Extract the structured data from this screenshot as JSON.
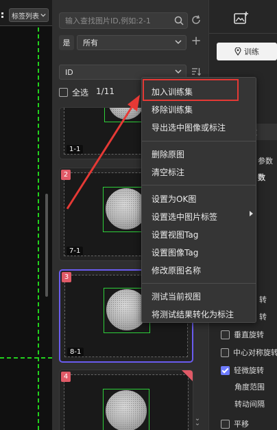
{
  "canvas": {
    "tag_list_label": "标签列表",
    "guide_color": "#23d11e"
  },
  "search": {
    "placeholder": "输入查找图片ID,例如:2-1"
  },
  "filter": {
    "operator": "是",
    "value": "所有"
  },
  "sort": {
    "field": "ID"
  },
  "selection": {
    "select_all_label": "全选",
    "count": "1/11"
  },
  "thumbnails": [
    {
      "index": "",
      "label": "1-1"
    },
    {
      "index": "2",
      "label": "7-1"
    },
    {
      "index": "3",
      "label": "8-1"
    },
    {
      "index": "4",
      "label": ""
    }
  ],
  "context_menu": {
    "items": [
      "加入训练集",
      "移除训练集",
      "导出选中图像或标注",
      "删除原图",
      "清空标注",
      "设置为OK图",
      "设置选中图片标签",
      "设置视图Tag",
      "设置图像Tag",
      "修改原图名称",
      "测试当前视图",
      "将测试结果转化为标注"
    ],
    "highlight_color": "#e53935"
  },
  "right_panel": {
    "train_button": "训练",
    "param_tab": "练参数",
    "param_label_1": "参数",
    "param_label_2": "数",
    "rot_1": "转",
    "rot_2": "转",
    "vertical_flip": "垂直旋转",
    "central_flip": "中心对称旋转",
    "slight_rotate": "轻微旋转",
    "angle_range": "角度范围",
    "rotate_interval": "转动间隔",
    "translate": "平移",
    "accent_color": "#6e7cff"
  },
  "colors": {
    "badge": "#e05a67",
    "active_border": "#6a5cf0",
    "box": "#2ed03a"
  }
}
